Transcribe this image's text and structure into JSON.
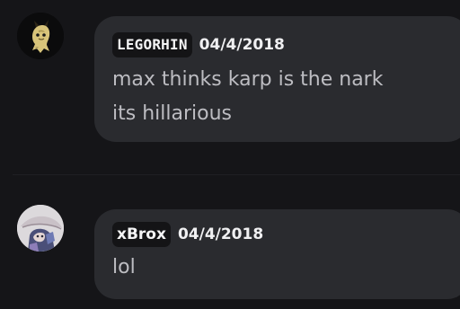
{
  "messages": [
    {
      "avatar_icon": "ghost-creature-avatar-icon",
      "username": "LEGORHIN",
      "timestamp": "04/4/2018",
      "lines": [
        "max thinks karp is the nark",
        "its hillarious"
      ]
    },
    {
      "avatar_icon": "character-avatar-icon",
      "username": "xBrox",
      "timestamp": "04/4/2018",
      "lines": [
        "lol"
      ]
    }
  ]
}
